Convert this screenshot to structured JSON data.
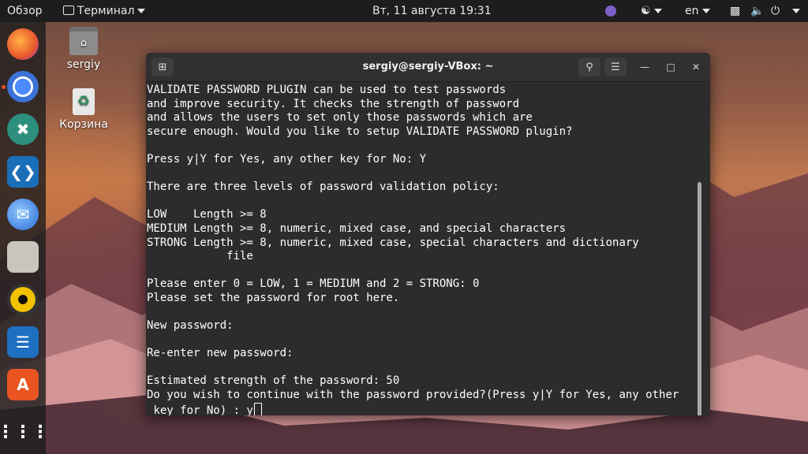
{
  "topbar": {
    "activities": "Обзор",
    "app_menu": "Терминал",
    "datetime": "Вт, 11 августа  19:31",
    "keyboard_layout": "en"
  },
  "desktop": {
    "icons": [
      {
        "label": "sergiy",
        "icon": "home-folder-icon"
      },
      {
        "label": "Корзина",
        "icon": "trash-icon"
      }
    ]
  },
  "dock": {
    "items": [
      "firefox-icon",
      "chromium-icon",
      "remmina-icon",
      "vscode-icon",
      "thunderbird-icon",
      "files-icon",
      "rhythmbox-icon",
      "writer-icon",
      "software-store-icon",
      "app-grid-icon"
    ]
  },
  "terminal": {
    "title": "sergiy@sergiy-VBox: ~",
    "lines": [
      "VALIDATE PASSWORD PLUGIN can be used to test passwords",
      "and improve security. It checks the strength of password",
      "and allows the users to set only those passwords which are",
      "secure enough. Would you like to setup VALIDATE PASSWORD plugin?",
      "",
      "Press y|Y for Yes, any other key for No: Y",
      "",
      "There are three levels of password validation policy:",
      "",
      "LOW    Length >= 8",
      "MEDIUM Length >= 8, numeric, mixed case, and special characters",
      "STRONG Length >= 8, numeric, mixed case, special characters and dictionary",
      "            file",
      "",
      "Please enter 0 = LOW, 1 = MEDIUM and 2 = STRONG: 0",
      "Please set the password for root here.",
      "",
      "New password:",
      "",
      "Re-enter new password:",
      "",
      "Estimated strength of the password: 50",
      "Do you wish to continue with the password provided?(Press y|Y for Yes, any other"
    ],
    "last_line": " key for No) : y"
  }
}
